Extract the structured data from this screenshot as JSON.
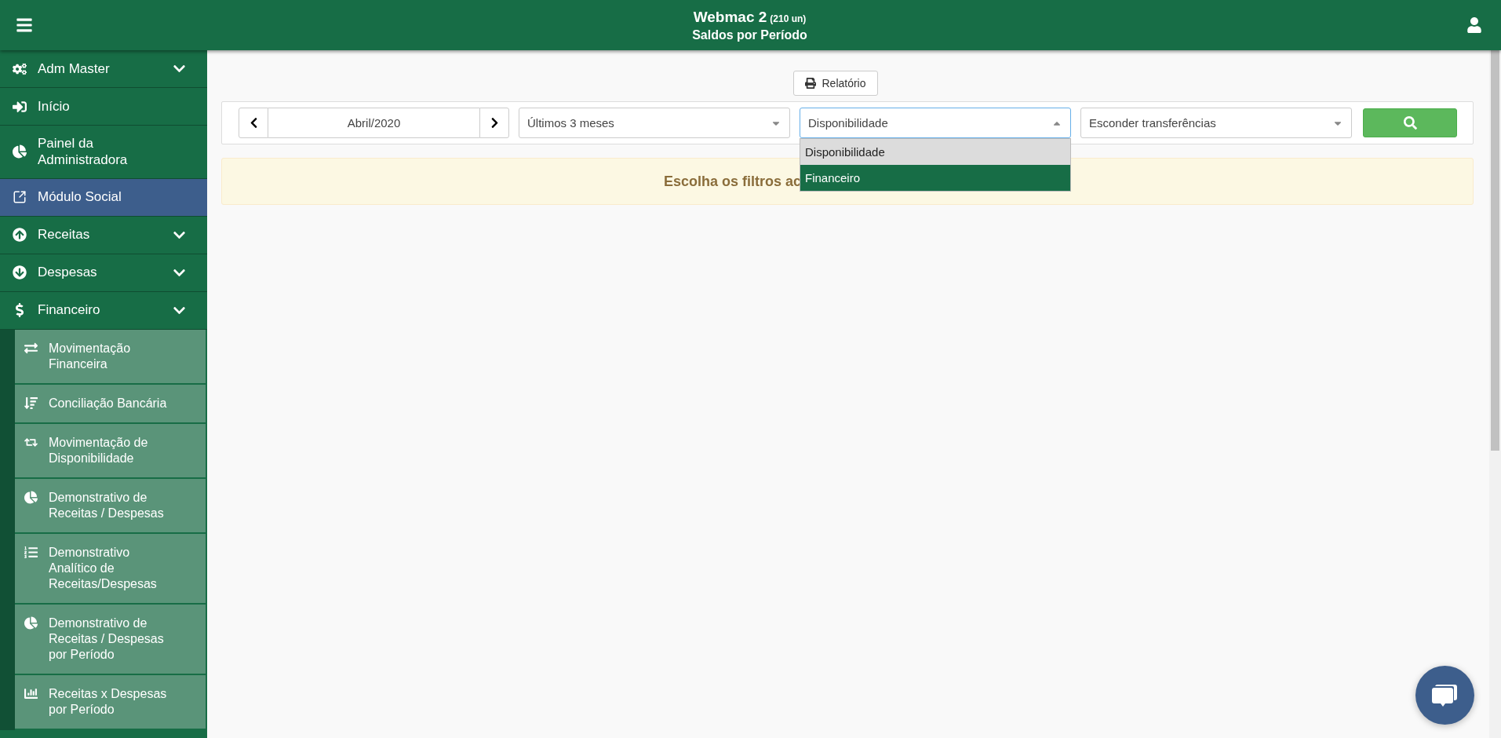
{
  "header": {
    "title": "Webmac 2",
    "units": "(210 un)",
    "subtitle": "Saldos por Período"
  },
  "sidebar": {
    "items": [
      {
        "label": "Adm Master",
        "kind": "group",
        "selected": false
      },
      {
        "label": "Início",
        "kind": "link",
        "selected": false
      },
      {
        "label": "Painel da Administradora",
        "kind": "link",
        "selected": false
      },
      {
        "label": "Módulo Social",
        "kind": "link",
        "selected": true
      },
      {
        "label": "Receitas",
        "kind": "group",
        "selected": false
      },
      {
        "label": "Despesas",
        "kind": "group",
        "selected": false
      },
      {
        "label": "Financeiro",
        "kind": "group",
        "selected": false,
        "children": [
          {
            "label": "Movimentação Financeira",
            "selected": false
          },
          {
            "label": "Conciliação Bancária",
            "selected": false
          },
          {
            "label": "Movimentação de Disponibilidade",
            "selected": false
          },
          {
            "label": "Demonstrativo de Receitas / Despesas",
            "selected": false
          },
          {
            "label": "Demonstrativo Analítico de Receitas/Despesas",
            "selected": false
          },
          {
            "label": "Demonstrativo de Receitas / Despesas por Período",
            "selected": false
          },
          {
            "label": "Receitas x Despesas por Período",
            "selected": false
          }
        ]
      }
    ]
  },
  "report_button": "Relatório",
  "filters": {
    "month": "Abril/2020",
    "period": {
      "value": "Últimos 3 meses",
      "open": false
    },
    "account_type": {
      "value": "Disponibilidade",
      "open": true,
      "options": [
        {
          "label": "Disponibilidade",
          "selected": true,
          "hovered": false
        },
        {
          "label": "Financeiro",
          "selected": false,
          "hovered": true
        }
      ]
    },
    "transfers": {
      "value": "Esconder transferências",
      "open": false
    }
  },
  "alert": "Escolha os filtros ac"
}
